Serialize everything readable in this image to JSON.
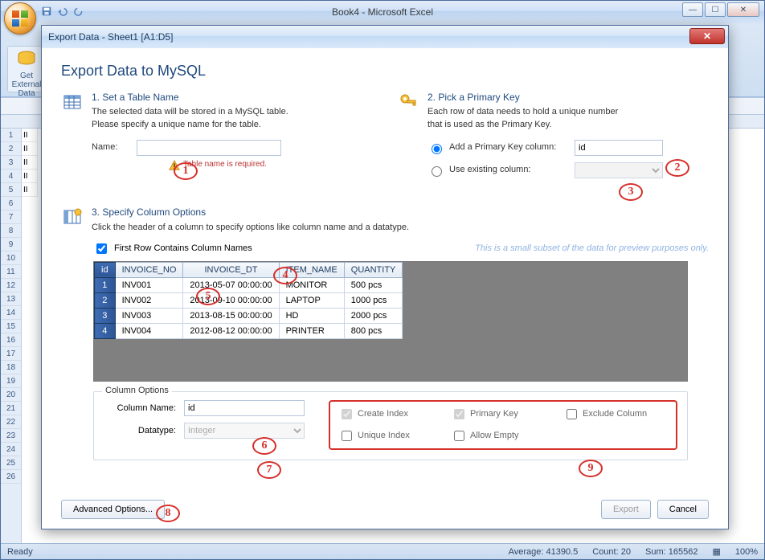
{
  "app": {
    "title": "Book4 - Microsoft Excel",
    "ribbon_group": "Get External Data",
    "status": {
      "ready": "Ready",
      "average_label": "Average:",
      "average_value": "41390.5",
      "count_label": "Count:",
      "count_value": "20",
      "sum_label": "Sum:",
      "sum_value": "165562",
      "zoom": "100%"
    }
  },
  "sheet": {
    "row_numbers": [
      "1",
      "2",
      "3",
      "4",
      "5",
      "6",
      "7",
      "8",
      "9",
      "10",
      "11",
      "12",
      "13",
      "14",
      "15",
      "16",
      "17",
      "18",
      "19",
      "20",
      "21",
      "22",
      "23",
      "24",
      "25",
      "26"
    ],
    "partial_cells": [
      "II",
      "II",
      "II",
      "II",
      "II"
    ]
  },
  "dialog": {
    "title": "Export Data - Sheet1 [A1:D5]",
    "heading": "Export Data to MySQL",
    "step1": {
      "title": "1. Set a Table Name",
      "desc1": "The selected data will be stored in a MySQL table.",
      "desc2": "Please specify a unique name for the table.",
      "name_label": "Name:",
      "name_value": "",
      "error": "Table name is required."
    },
    "step2": {
      "title": "2. Pick a Primary Key",
      "desc1": "Each row of data needs to hold a unique number",
      "desc2": "that is used as the Primary Key.",
      "opt_add": "Add a Primary Key column:",
      "add_value": "id",
      "opt_use": "Use existing column:",
      "use_value": ""
    },
    "step3": {
      "title": "3. Specify Column Options",
      "desc": "Click the header of a column to specify options like column name and a datatype.",
      "first_row_label": "First Row Contains Column Names",
      "preview_note": "This is a small subset of the data for preview purposes only."
    },
    "grid": {
      "columns": [
        "id",
        "INVOICE_NO",
        "INVOICE_DT",
        "ITEM_NAME",
        "QUANTITY"
      ],
      "rows": [
        {
          "n": "1",
          "invoice_no": "INV001",
          "invoice_dt": "2013-05-07 00:00:00",
          "item": "MONITOR",
          "qty": "500 pcs"
        },
        {
          "n": "2",
          "invoice_no": "INV002",
          "invoice_dt": "2013-09-10 00:00:00",
          "item": "LAPTOP",
          "qty": "1000 pcs"
        },
        {
          "n": "3",
          "invoice_no": "INV003",
          "invoice_dt": "2013-08-15 00:00:00",
          "item": "HD",
          "qty": "2000 pcs"
        },
        {
          "n": "4",
          "invoice_no": "INV004",
          "invoice_dt": "2012-08-12 00:00:00",
          "item": "PRINTER",
          "qty": "800 pcs"
        }
      ]
    },
    "col_opts": {
      "legend": "Column Options",
      "name_label": "Column Name:",
      "name_value": "id",
      "datatype_label": "Datatype:",
      "datatype_value": "Integer",
      "checks": {
        "create_index": "Create Index",
        "primary_key": "Primary Key",
        "exclude_column": "Exclude Column",
        "unique_index": "Unique Index",
        "allow_empty": "Allow Empty"
      }
    },
    "buttons": {
      "advanced": "Advanced Options...",
      "export": "Export",
      "cancel": "Cancel"
    }
  },
  "annotations": {
    "1": "1",
    "2": "2",
    "3": "3",
    "4": "4",
    "5": "5",
    "6": "6",
    "7": "7",
    "8": "8",
    "9": "9"
  }
}
